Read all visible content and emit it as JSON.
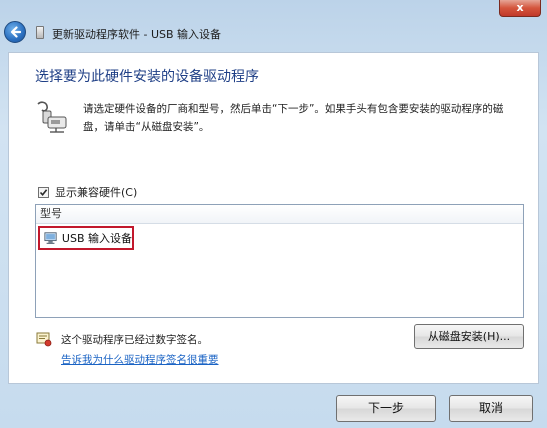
{
  "window": {
    "close_label": "x",
    "title": "更新驱动程序软件 - USB 输入设备"
  },
  "main": {
    "heading": "选择要为此硬件安装的设备驱动程序",
    "instruction": "请选定硬件设备的厂商和型号，然后单击“下一步”。如果手头有包含要安装的驱动程序的磁盘，请单击“从磁盘安装”。",
    "show_compatible": {
      "label": "显示兼容硬件(C)",
      "checked": true
    },
    "list": {
      "column_header": "型号",
      "items": [
        {
          "label": "USB 输入设备",
          "selected": true
        }
      ]
    },
    "signed_text": "这个驱动程序已经过数字签名。",
    "help_link": "告诉我为什么驱动程序签名很重要",
    "have_disk_button": "从磁盘安装(H)..."
  },
  "footer": {
    "next_button": "下一步",
    "cancel_button": "取消"
  },
  "icons": {
    "back": "back-arrow-icon",
    "device": "hardware-device-icon",
    "monitor": "monitor-device-icon",
    "signature": "signed-certificate-icon",
    "checkmark": "checkmark-icon"
  },
  "colors": {
    "heading": "#1f3f86",
    "link": "#1a63c4",
    "selection_border": "#c2182c",
    "chrome": "#c6dbee"
  }
}
